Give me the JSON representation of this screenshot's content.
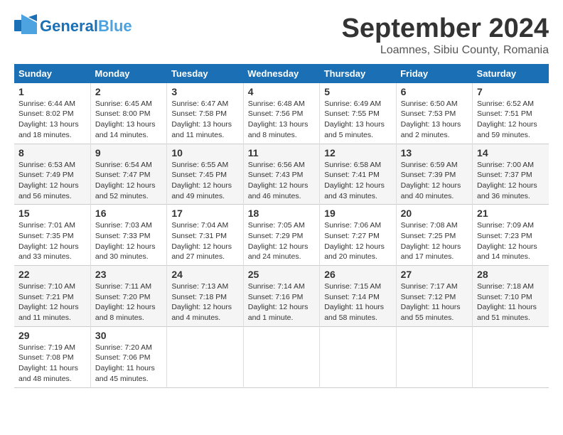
{
  "header": {
    "logo_general": "General",
    "logo_blue": "Blue",
    "month_title": "September 2024",
    "location": "Loamnes, Sibiu County, Romania"
  },
  "calendar": {
    "days_of_week": [
      "Sunday",
      "Monday",
      "Tuesday",
      "Wednesday",
      "Thursday",
      "Friday",
      "Saturday"
    ],
    "weeks": [
      [
        {
          "day": "1",
          "info": "Sunrise: 6:44 AM\nSunset: 8:02 PM\nDaylight: 13 hours and 18 minutes."
        },
        {
          "day": "2",
          "info": "Sunrise: 6:45 AM\nSunset: 8:00 PM\nDaylight: 13 hours and 14 minutes."
        },
        {
          "day": "3",
          "info": "Sunrise: 6:47 AM\nSunset: 7:58 PM\nDaylight: 13 hours and 11 minutes."
        },
        {
          "day": "4",
          "info": "Sunrise: 6:48 AM\nSunset: 7:56 PM\nDaylight: 13 hours and 8 minutes."
        },
        {
          "day": "5",
          "info": "Sunrise: 6:49 AM\nSunset: 7:55 PM\nDaylight: 13 hours and 5 minutes."
        },
        {
          "day": "6",
          "info": "Sunrise: 6:50 AM\nSunset: 7:53 PM\nDaylight: 13 hours and 2 minutes."
        },
        {
          "day": "7",
          "info": "Sunrise: 6:52 AM\nSunset: 7:51 PM\nDaylight: 12 hours and 59 minutes."
        }
      ],
      [
        {
          "day": "8",
          "info": "Sunrise: 6:53 AM\nSunset: 7:49 PM\nDaylight: 12 hours and 56 minutes."
        },
        {
          "day": "9",
          "info": "Sunrise: 6:54 AM\nSunset: 7:47 PM\nDaylight: 12 hours and 52 minutes."
        },
        {
          "day": "10",
          "info": "Sunrise: 6:55 AM\nSunset: 7:45 PM\nDaylight: 12 hours and 49 minutes."
        },
        {
          "day": "11",
          "info": "Sunrise: 6:56 AM\nSunset: 7:43 PM\nDaylight: 12 hours and 46 minutes."
        },
        {
          "day": "12",
          "info": "Sunrise: 6:58 AM\nSunset: 7:41 PM\nDaylight: 12 hours and 43 minutes."
        },
        {
          "day": "13",
          "info": "Sunrise: 6:59 AM\nSunset: 7:39 PM\nDaylight: 12 hours and 40 minutes."
        },
        {
          "day": "14",
          "info": "Sunrise: 7:00 AM\nSunset: 7:37 PM\nDaylight: 12 hours and 36 minutes."
        }
      ],
      [
        {
          "day": "15",
          "info": "Sunrise: 7:01 AM\nSunset: 7:35 PM\nDaylight: 12 hours and 33 minutes."
        },
        {
          "day": "16",
          "info": "Sunrise: 7:03 AM\nSunset: 7:33 PM\nDaylight: 12 hours and 30 minutes."
        },
        {
          "day": "17",
          "info": "Sunrise: 7:04 AM\nSunset: 7:31 PM\nDaylight: 12 hours and 27 minutes."
        },
        {
          "day": "18",
          "info": "Sunrise: 7:05 AM\nSunset: 7:29 PM\nDaylight: 12 hours and 24 minutes."
        },
        {
          "day": "19",
          "info": "Sunrise: 7:06 AM\nSunset: 7:27 PM\nDaylight: 12 hours and 20 minutes."
        },
        {
          "day": "20",
          "info": "Sunrise: 7:08 AM\nSunset: 7:25 PM\nDaylight: 12 hours and 17 minutes."
        },
        {
          "day": "21",
          "info": "Sunrise: 7:09 AM\nSunset: 7:23 PM\nDaylight: 12 hours and 14 minutes."
        }
      ],
      [
        {
          "day": "22",
          "info": "Sunrise: 7:10 AM\nSunset: 7:21 PM\nDaylight: 12 hours and 11 minutes."
        },
        {
          "day": "23",
          "info": "Sunrise: 7:11 AM\nSunset: 7:20 PM\nDaylight: 12 hours and 8 minutes."
        },
        {
          "day": "24",
          "info": "Sunrise: 7:13 AM\nSunset: 7:18 PM\nDaylight: 12 hours and 4 minutes."
        },
        {
          "day": "25",
          "info": "Sunrise: 7:14 AM\nSunset: 7:16 PM\nDaylight: 12 hours and 1 minute."
        },
        {
          "day": "26",
          "info": "Sunrise: 7:15 AM\nSunset: 7:14 PM\nDaylight: 11 hours and 58 minutes."
        },
        {
          "day": "27",
          "info": "Sunrise: 7:17 AM\nSunset: 7:12 PM\nDaylight: 11 hours and 55 minutes."
        },
        {
          "day": "28",
          "info": "Sunrise: 7:18 AM\nSunset: 7:10 PM\nDaylight: 11 hours and 51 minutes."
        }
      ],
      [
        {
          "day": "29",
          "info": "Sunrise: 7:19 AM\nSunset: 7:08 PM\nDaylight: 11 hours and 48 minutes."
        },
        {
          "day": "30",
          "info": "Sunrise: 7:20 AM\nSunset: 7:06 PM\nDaylight: 11 hours and 45 minutes."
        },
        {
          "day": "",
          "info": ""
        },
        {
          "day": "",
          "info": ""
        },
        {
          "day": "",
          "info": ""
        },
        {
          "day": "",
          "info": ""
        },
        {
          "day": "",
          "info": ""
        }
      ]
    ]
  }
}
